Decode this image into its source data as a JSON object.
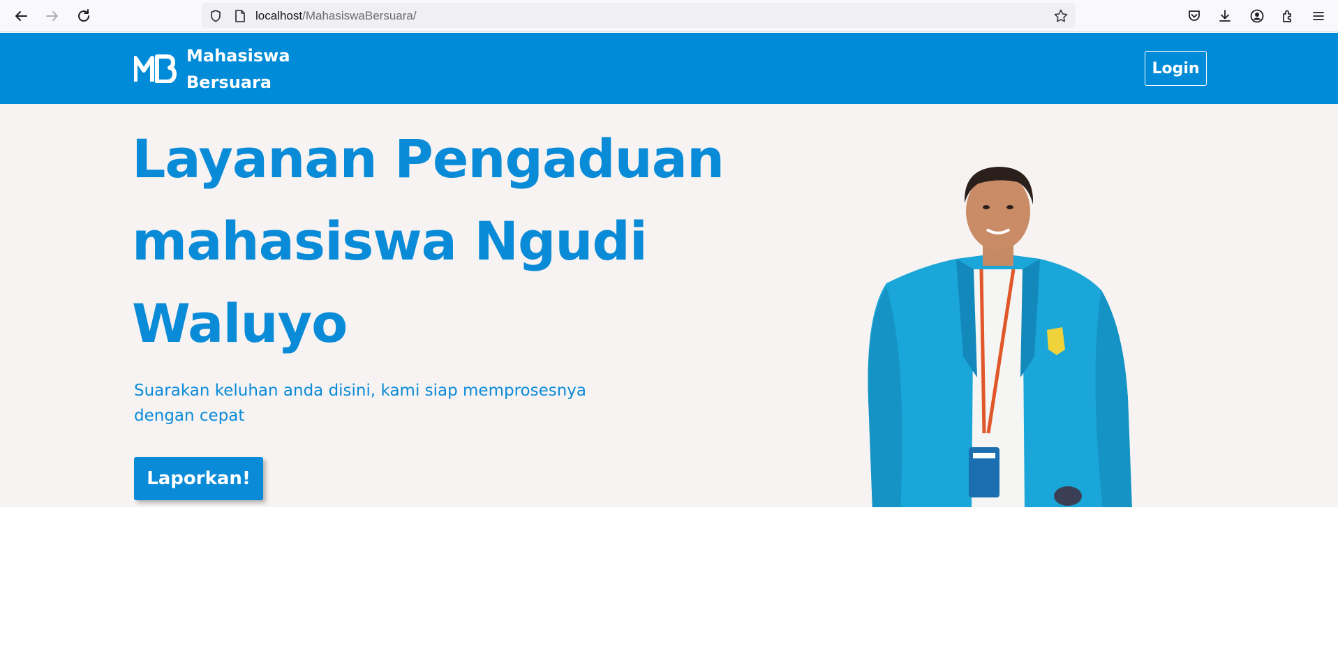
{
  "browser": {
    "url_host": "localhost",
    "url_path": "/MahasiswaBersuara/"
  },
  "header": {
    "logo_text": "MB",
    "brand_line1": "Mahasiswa",
    "brand_line2": "Bersuara",
    "login_label": "Login"
  },
  "hero": {
    "title": "Layanan Pengaduan mahasiswa Ngudi Waluyo",
    "subtitle": "Suarakan keluhan anda disini, kami siap memprosesnya dengan cepat",
    "cta_label": "Laporkan!"
  },
  "colors": {
    "brand_blue": "#008bd9",
    "hero_bg": "#f7f3f2",
    "jacket": "#1aa6d8"
  }
}
